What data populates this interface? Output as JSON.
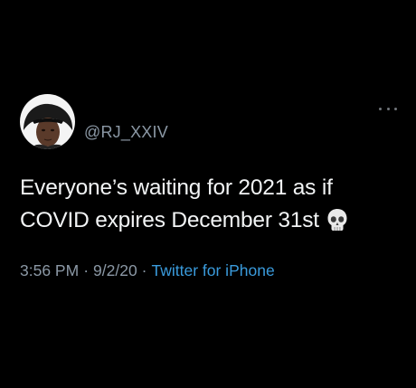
{
  "tweet": {
    "handle": "@RJ_XXIV",
    "text_line1": "Everyone’s waiting for 2021 as if",
    "text_line2": "COVID expires December 31st",
    "emoji": "skull-emoji",
    "time": "3:56 PM",
    "separator": "·",
    "date": "9/2/20",
    "source": "Twitter for iPhone"
  },
  "colors": {
    "background": "#000000",
    "text": "#f2f4f5",
    "secondary": "#8b98a5",
    "link": "#3a9bdc"
  },
  "icons": {
    "more": "more-options-icon",
    "avatar": "avatar"
  }
}
